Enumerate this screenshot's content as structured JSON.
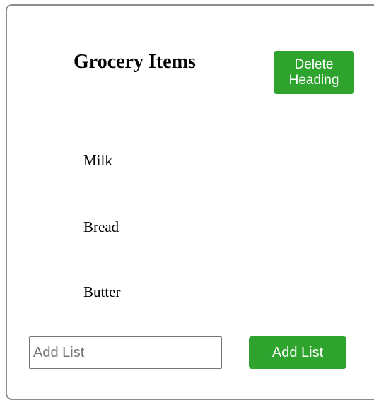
{
  "heading": {
    "title": "Grocery Items",
    "delete_label": "Delete Heading"
  },
  "items": [
    {
      "label": "Milk"
    },
    {
      "label": "Bread"
    },
    {
      "label": "Butter"
    }
  ],
  "add_form": {
    "input_value": "",
    "placeholder": "Add List",
    "button_label": "Add List"
  },
  "colors": {
    "button_bg": "#2ea32e",
    "button_text": "#ffffff",
    "card_border": "#8c8c8c"
  }
}
